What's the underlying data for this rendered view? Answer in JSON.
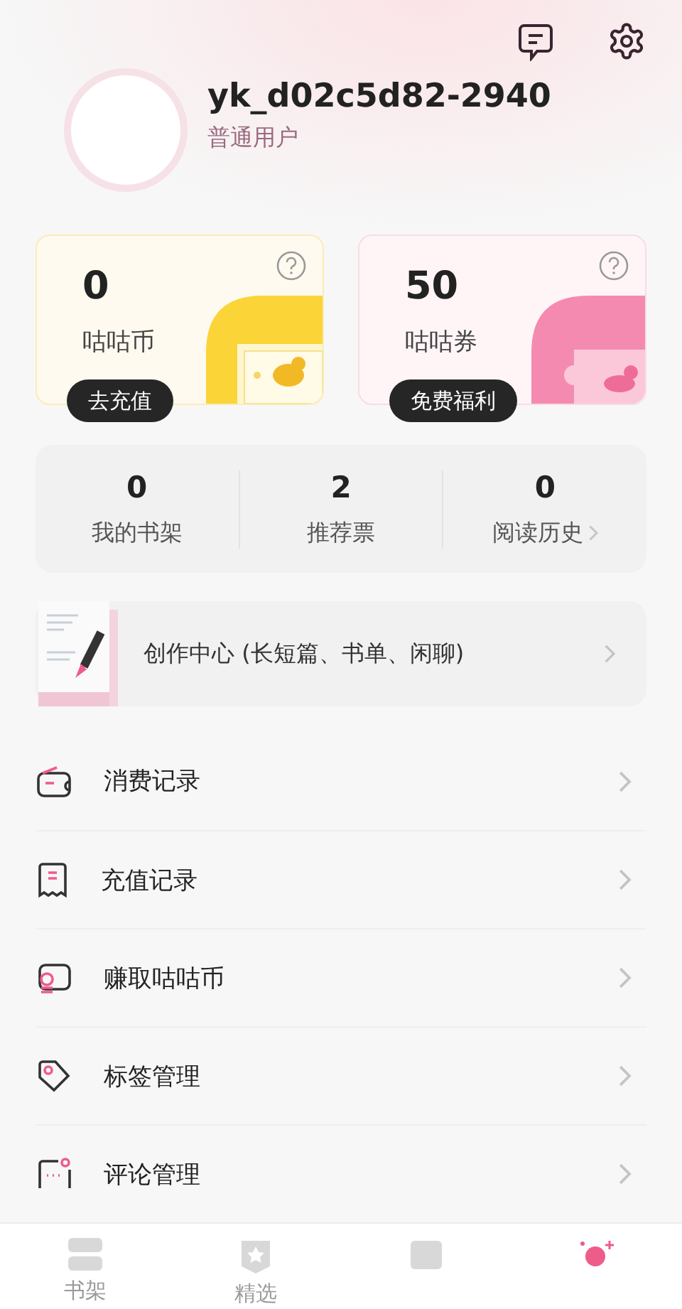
{
  "header": {
    "username": "yk_d02c5d82-2940",
    "user_level": "普通用户"
  },
  "wallet_cards": [
    {
      "kind": "coin",
      "amount": "0",
      "label": "咕咕币",
      "button": "去充值"
    },
    {
      "kind": "voucher",
      "amount": "50",
      "label": "咕咕券",
      "button": "免费福利"
    }
  ],
  "stats": [
    {
      "value": "0",
      "label": "我的书架",
      "has_arrow": false
    },
    {
      "value": "2",
      "label": "推荐票",
      "has_arrow": false
    },
    {
      "value": "0",
      "label": "阅读历史",
      "has_arrow": true
    }
  ],
  "creation_center": {
    "label": "创作中心 (长短篇、书单、闲聊)"
  },
  "menu": [
    {
      "kind": "wallet",
      "label": "消费记录"
    },
    {
      "kind": "receipt",
      "label": "充值记录"
    },
    {
      "kind": "coins",
      "label": "赚取咕咕币"
    },
    {
      "kind": "tag",
      "label": "标签管理"
    },
    {
      "kind": "comment",
      "label": "评论管理"
    }
  ],
  "tab_bar": [
    {
      "kind": "shelf",
      "label": "书架",
      "selected": false
    },
    {
      "kind": "featured",
      "label": "精选",
      "selected": false
    },
    {
      "kind": "book",
      "selected": false
    },
    {
      "kind": "profile",
      "selected": true
    }
  ]
}
